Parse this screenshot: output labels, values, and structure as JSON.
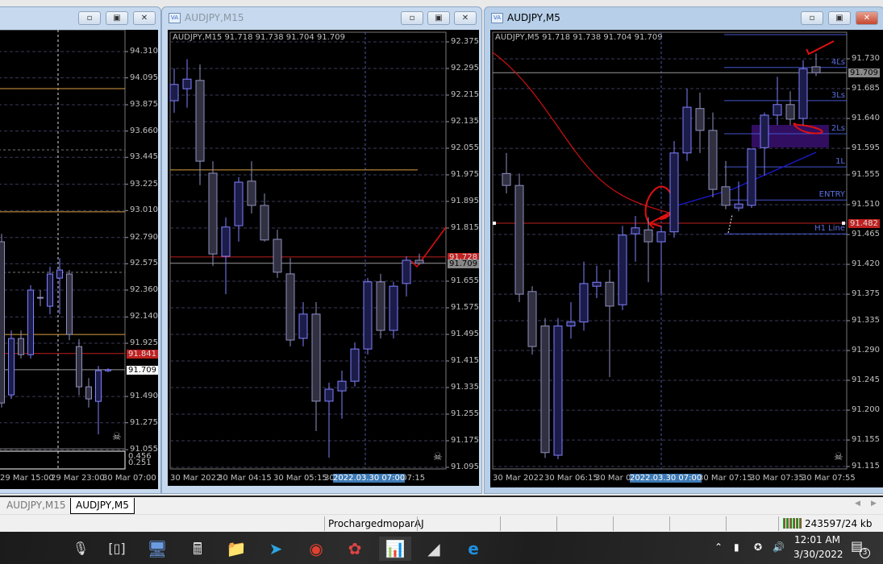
{
  "windows": {
    "left": {
      "title": "",
      "price_labels": [
        "94.310",
        "94.095",
        "93.875",
        "93.660",
        "93.445",
        "93.225",
        "93.010",
        "92.790",
        "92.575",
        "92.360",
        "92.140",
        "91.925",
        "91.490",
        "91.275",
        "91.055"
      ],
      "bid_tag": "91.841",
      "last_tag": "91.709",
      "indicator_labels": [
        "0.456",
        "0.251"
      ],
      "time_labels": [
        "29 Mar 15:00",
        "29 Mar 23:00",
        "30 Mar 07:00"
      ],
      "candles": [
        [
          92.755,
          92.82,
          91.4,
          91.437
        ],
        [
          91.503,
          92.03,
          91.47,
          91.964
        ],
        [
          91.964,
          92.03,
          91.8,
          91.832
        ],
        [
          91.832,
          92.4,
          91.8,
          92.36
        ],
        [
          92.3,
          92.36,
          92.228,
          92.294
        ],
        [
          92.228,
          92.55,
          92.162,
          92.491
        ],
        [
          92.458,
          92.62,
          92.162,
          92.524
        ],
        [
          92.491,
          92.524,
          91.95,
          91.997
        ],
        [
          91.898,
          91.96,
          91.5,
          91.569
        ],
        [
          91.569,
          91.64,
          91.4,
          91.47
        ],
        [
          91.45,
          91.74,
          91.18,
          91.701
        ],
        [
          91.7,
          91.72,
          91.69,
          91.709
        ]
      ],
      "hlines": {
        "orange": [
          94.007,
          93.0,
          91.997
        ],
        "gray_dashed": [
          93.506,
          92.505
        ],
        "red": 91.841,
        "gray": 91.709
      }
    },
    "m15": {
      "title": "AUDJPY,M15",
      "header": "AUDJPY,M15  91.718 91.738 91.704 91.709",
      "price_labels": [
        "92.375",
        "92.295",
        "92.215",
        "92.135",
        "92.055",
        "91.975",
        "91.895",
        "91.815",
        "91.655",
        "91.575",
        "91.495",
        "91.415",
        "91.335",
        "91.255",
        "91.175",
        "91.095"
      ],
      "bid_tag": "91.728",
      "last_tag": "91.709",
      "time_labels": [
        "30 Mar 2022",
        "30 Mar 04:15",
        "30 Mar 05:15",
        "30",
        "r 07:15"
      ],
      "crosshair_time": "2022.03.30 07:00",
      "candles": [
        [
          92.198,
          92.295,
          92.162,
          92.247
        ],
        [
          92.234,
          92.323,
          92.177,
          92.263
        ],
        [
          92.259,
          92.307,
          91.944,
          92.016
        ],
        [
          91.98,
          92.016,
          91.701,
          91.737
        ],
        [
          91.73,
          91.847,
          91.616,
          91.818
        ],
        [
          91.822,
          91.968,
          91.774,
          91.953
        ],
        [
          91.956,
          92.016,
          91.859,
          91.883
        ],
        [
          91.883,
          91.919,
          91.774,
          91.779
        ],
        [
          91.781,
          91.81,
          91.665,
          91.682
        ],
        [
          91.677,
          91.725,
          91.459,
          91.478
        ],
        [
          91.483,
          91.592,
          91.459,
          91.556
        ],
        [
          91.556,
          91.592,
          91.204,
          91.294
        ],
        [
          91.294,
          91.35,
          91.124,
          91.33
        ],
        [
          91.325,
          91.386,
          91.241,
          91.354
        ],
        [
          91.354,
          91.471,
          91.338,
          91.451
        ],
        [
          91.451,
          91.665,
          91.434,
          91.653
        ],
        [
          91.653,
          91.677,
          91.483,
          91.507
        ],
        [
          91.507,
          91.653,
          91.483,
          91.64
        ],
        [
          91.648,
          91.73,
          91.609,
          91.718
        ],
        [
          91.718,
          91.738,
          91.704,
          91.709
        ]
      ],
      "hlines": {
        "orange": [
          91.99
        ],
        "red": 91.728,
        "gray": 91.709
      }
    },
    "m5": {
      "title": "AUDJPY,M5",
      "header": "AUDJPY,M5  91.718 91.738 91.704 91.709",
      "price_labels": [
        "91.730",
        "91.685",
        "91.640",
        "91.595",
        "91.555",
        "91.510",
        "91.465",
        "91.420",
        "91.375",
        "91.335",
        "91.290",
        "91.245",
        "91.200",
        "91.155",
        "91.115"
      ],
      "bid_tag": "91.482",
      "last_tag": "91.709",
      "time_labels": [
        "30 Mar 2022",
        "30 Mar 06:15",
        "30 Mar 06",
        "30 Mar 07:15",
        "30 Mar 07:35",
        "30 Mar 07:55"
      ],
      "crosshair_time": "2022.03.30 07:00",
      "levels": [
        {
          "label": "4Ls",
          "price": 91.717
        },
        {
          "label": "3Ls",
          "price": 91.667
        },
        {
          "label": "2Ls",
          "price": 91.617
        },
        {
          "label": "1L",
          "price": 91.567
        },
        {
          "label": "ENTRY",
          "price": 91.517
        },
        {
          "label": "H1 Line",
          "price": 91.466
        }
      ],
      "candles": [
        [
          91.557,
          91.588,
          91.527,
          91.539
        ],
        [
          91.539,
          91.557,
          91.363,
          91.375
        ],
        [
          91.379,
          91.387,
          91.284,
          91.296
        ],
        [
          91.327,
          91.339,
          91.128,
          91.136
        ],
        [
          91.132,
          91.339,
          91.126,
          91.327
        ],
        [
          91.327,
          91.363,
          91.308,
          91.333
        ],
        [
          91.333,
          91.424,
          91.32,
          91.391
        ],
        [
          91.387,
          91.418,
          91.369,
          91.393
        ],
        [
          91.393,
          91.412,
          91.25,
          91.357
        ],
        [
          91.359,
          91.478,
          91.351,
          91.464
        ],
        [
          91.466,
          91.493,
          91.424,
          91.475
        ],
        [
          91.472,
          91.491,
          91.393,
          91.454
        ],
        [
          91.454,
          91.478,
          91.375,
          91.469
        ],
        [
          91.469,
          91.606,
          91.46,
          91.588
        ],
        [
          91.588,
          91.685,
          91.576,
          91.657
        ],
        [
          91.655,
          91.679,
          91.588,
          91.622
        ],
        [
          91.622,
          91.649,
          91.521,
          91.533
        ],
        [
          91.537,
          91.576,
          91.503,
          91.509
        ],
        [
          91.505,
          91.545,
          91.5,
          91.511
        ],
        [
          91.509,
          91.594,
          91.505,
          91.594
        ],
        [
          91.596,
          91.649,
          91.554,
          91.645
        ],
        [
          91.645,
          91.703,
          91.63,
          91.661
        ],
        [
          91.661,
          91.681,
          91.63,
          91.639
        ],
        [
          91.64,
          91.728,
          91.63,
          91.715
        ],
        [
          91.718,
          91.738,
          91.704,
          91.709
        ]
      ],
      "hlines": {
        "red": 91.482,
        "gray": 91.709
      }
    }
  },
  "tabs": [
    {
      "label": "AUDJPY,M15",
      "selected": false
    },
    {
      "label": "AUDJPY,M5",
      "selected": true
    }
  ],
  "status": {
    "profile": "ProchargedmoparAJ",
    "traffic": "243597/24 kb"
  },
  "taskbar": {
    "time": "12:01 AM",
    "date": "3/30/2022",
    "notifications": "3"
  },
  "colors": {
    "bull_body": "#1c1c4a",
    "bull_edge": "#8080ff",
    "bear_body": "#303040",
    "bear_edge": "#9090c0",
    "orange": "#d9a040",
    "red": "#c02020",
    "level_blue": "#4455cc"
  }
}
